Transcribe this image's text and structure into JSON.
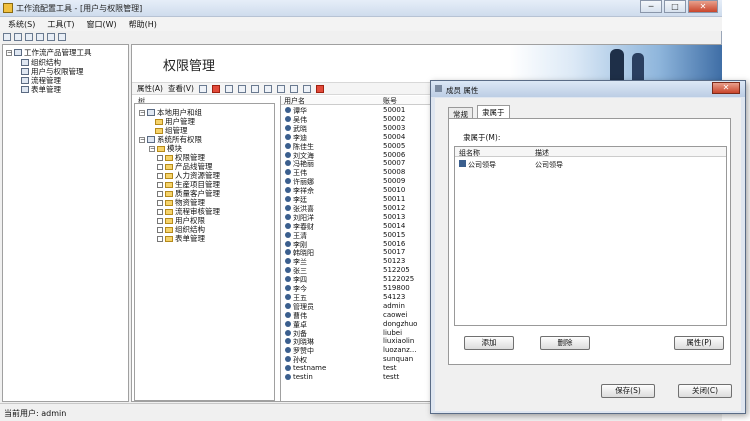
{
  "window": {
    "title": "工作流配置工具 - [用户与权限管理]",
    "minimize": "─",
    "restore": "□",
    "close": "✕"
  },
  "menu": [
    "系统(S)",
    "工具(T)",
    "窗口(W)",
    "帮助(H)"
  ],
  "left_tree": {
    "root": "工作流产品管理工具",
    "items": [
      "组织结构",
      "用户与权限管理",
      "流程管理",
      "表单管理"
    ]
  },
  "content": {
    "page_title": "权限管理",
    "toolbar": {
      "properties": "属性(A)",
      "view": "查看(V)"
    },
    "tree_header": "树",
    "perm_tree": {
      "local_groups": "本地用户和组",
      "users": "用户管理",
      "groups": "组管理",
      "system_perms": "系统所有权限",
      "module": "模块",
      "modules": [
        "权限管理",
        "产品线管理",
        "人力资源管理",
        "生産项目管理",
        "质量客户管理",
        "物资管理",
        "流程审核管理",
        "用户权限",
        "组织结构",
        "表单管理"
      ]
    },
    "user_table": {
      "col_name": "用户名",
      "col_account": "账号",
      "rows": [
        [
          "谭华",
          "50001"
        ],
        [
          "吴伟",
          "50002"
        ],
        [
          "武晓",
          "50003"
        ],
        [
          "李迪",
          "50004"
        ],
        [
          "陈佳生",
          "50005"
        ],
        [
          "刘文海",
          "50006"
        ],
        [
          "冯艳丽",
          "50007"
        ],
        [
          "王伟",
          "50008"
        ],
        [
          "许丽娜",
          "50009"
        ],
        [
          "李祥佘",
          "50010"
        ],
        [
          "李廷",
          "50011"
        ],
        [
          "张洪喜",
          "50012"
        ],
        [
          "刘阳洋",
          "50013"
        ],
        [
          "李春财",
          "50014"
        ],
        [
          "王清",
          "50015"
        ],
        [
          "李刚",
          "50016"
        ],
        [
          "韩晓阳",
          "50017"
        ],
        [
          "李兰",
          "50123"
        ],
        [
          "张三",
          "512205"
        ],
        [
          "李四",
          "5122025"
        ],
        [
          "李今",
          "519800"
        ],
        [
          "王五",
          "54123"
        ],
        [
          "管理员",
          "admin"
        ],
        [
          "曹伟",
          "caowei"
        ],
        [
          "董卓",
          "dongzhuo"
        ],
        [
          "刘备",
          "liubei"
        ],
        [
          "刘晓琳",
          "liuxiaolin"
        ],
        [
          "罗赞中",
          "luozanz..."
        ],
        [
          "孙权",
          "sunquan"
        ],
        [
          "testname",
          "test"
        ],
        [
          "testin",
          "testt"
        ]
      ]
    }
  },
  "status": {
    "current_user": "当前用户: admin"
  },
  "dialog": {
    "title": "成员 属性",
    "close": "✕",
    "tabs": [
      "常规",
      "隶属于"
    ],
    "belong_label": "隶属于(M):",
    "col_group": "组名称",
    "col_desc": "描述",
    "rows": [
      [
        "公司领导",
        "公司领导"
      ]
    ],
    "add": "添加",
    "delete": "删除",
    "props": "属性(P)",
    "save": "保存(S)",
    "close_btn": "关闭(C)"
  }
}
